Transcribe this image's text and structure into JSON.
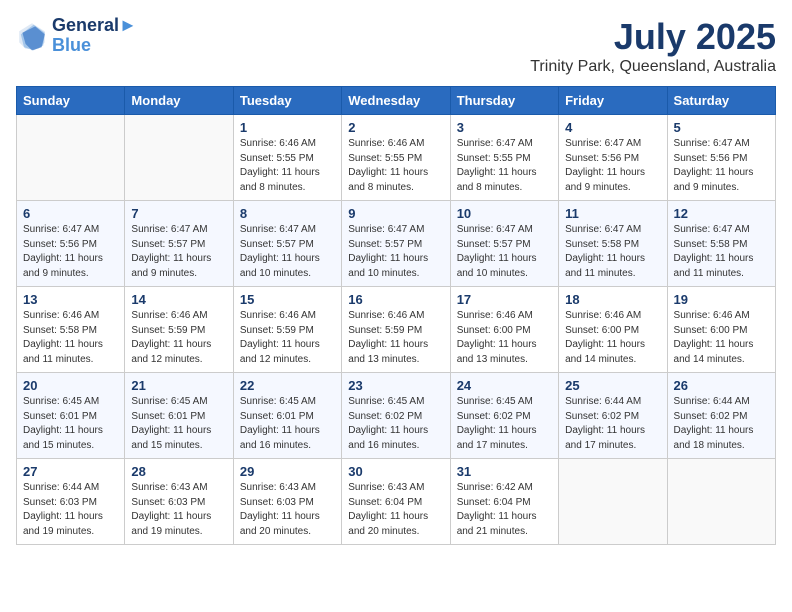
{
  "header": {
    "logo_line1": "General",
    "logo_line2": "Blue",
    "title": "July 2025",
    "subtitle": "Trinity Park, Queensland, Australia"
  },
  "weekdays": [
    "Sunday",
    "Monday",
    "Tuesday",
    "Wednesday",
    "Thursday",
    "Friday",
    "Saturday"
  ],
  "weeks": [
    [
      {
        "day": "",
        "info": ""
      },
      {
        "day": "",
        "info": ""
      },
      {
        "day": "1",
        "info": "Sunrise: 6:46 AM\nSunset: 5:55 PM\nDaylight: 11 hours and 8 minutes."
      },
      {
        "day": "2",
        "info": "Sunrise: 6:46 AM\nSunset: 5:55 PM\nDaylight: 11 hours and 8 minutes."
      },
      {
        "day": "3",
        "info": "Sunrise: 6:47 AM\nSunset: 5:55 PM\nDaylight: 11 hours and 8 minutes."
      },
      {
        "day": "4",
        "info": "Sunrise: 6:47 AM\nSunset: 5:56 PM\nDaylight: 11 hours and 9 minutes."
      },
      {
        "day": "5",
        "info": "Sunrise: 6:47 AM\nSunset: 5:56 PM\nDaylight: 11 hours and 9 minutes."
      }
    ],
    [
      {
        "day": "6",
        "info": "Sunrise: 6:47 AM\nSunset: 5:56 PM\nDaylight: 11 hours and 9 minutes."
      },
      {
        "day": "7",
        "info": "Sunrise: 6:47 AM\nSunset: 5:57 PM\nDaylight: 11 hours and 9 minutes."
      },
      {
        "day": "8",
        "info": "Sunrise: 6:47 AM\nSunset: 5:57 PM\nDaylight: 11 hours and 10 minutes."
      },
      {
        "day": "9",
        "info": "Sunrise: 6:47 AM\nSunset: 5:57 PM\nDaylight: 11 hours and 10 minutes."
      },
      {
        "day": "10",
        "info": "Sunrise: 6:47 AM\nSunset: 5:57 PM\nDaylight: 11 hours and 10 minutes."
      },
      {
        "day": "11",
        "info": "Sunrise: 6:47 AM\nSunset: 5:58 PM\nDaylight: 11 hours and 11 minutes."
      },
      {
        "day": "12",
        "info": "Sunrise: 6:47 AM\nSunset: 5:58 PM\nDaylight: 11 hours and 11 minutes."
      }
    ],
    [
      {
        "day": "13",
        "info": "Sunrise: 6:46 AM\nSunset: 5:58 PM\nDaylight: 11 hours and 11 minutes."
      },
      {
        "day": "14",
        "info": "Sunrise: 6:46 AM\nSunset: 5:59 PM\nDaylight: 11 hours and 12 minutes."
      },
      {
        "day": "15",
        "info": "Sunrise: 6:46 AM\nSunset: 5:59 PM\nDaylight: 11 hours and 12 minutes."
      },
      {
        "day": "16",
        "info": "Sunrise: 6:46 AM\nSunset: 5:59 PM\nDaylight: 11 hours and 13 minutes."
      },
      {
        "day": "17",
        "info": "Sunrise: 6:46 AM\nSunset: 6:00 PM\nDaylight: 11 hours and 13 minutes."
      },
      {
        "day": "18",
        "info": "Sunrise: 6:46 AM\nSunset: 6:00 PM\nDaylight: 11 hours and 14 minutes."
      },
      {
        "day": "19",
        "info": "Sunrise: 6:46 AM\nSunset: 6:00 PM\nDaylight: 11 hours and 14 minutes."
      }
    ],
    [
      {
        "day": "20",
        "info": "Sunrise: 6:45 AM\nSunset: 6:01 PM\nDaylight: 11 hours and 15 minutes."
      },
      {
        "day": "21",
        "info": "Sunrise: 6:45 AM\nSunset: 6:01 PM\nDaylight: 11 hours and 15 minutes."
      },
      {
        "day": "22",
        "info": "Sunrise: 6:45 AM\nSunset: 6:01 PM\nDaylight: 11 hours and 16 minutes."
      },
      {
        "day": "23",
        "info": "Sunrise: 6:45 AM\nSunset: 6:02 PM\nDaylight: 11 hours and 16 minutes."
      },
      {
        "day": "24",
        "info": "Sunrise: 6:45 AM\nSunset: 6:02 PM\nDaylight: 11 hours and 17 minutes."
      },
      {
        "day": "25",
        "info": "Sunrise: 6:44 AM\nSunset: 6:02 PM\nDaylight: 11 hours and 17 minutes."
      },
      {
        "day": "26",
        "info": "Sunrise: 6:44 AM\nSunset: 6:02 PM\nDaylight: 11 hours and 18 minutes."
      }
    ],
    [
      {
        "day": "27",
        "info": "Sunrise: 6:44 AM\nSunset: 6:03 PM\nDaylight: 11 hours and 19 minutes."
      },
      {
        "day": "28",
        "info": "Sunrise: 6:43 AM\nSunset: 6:03 PM\nDaylight: 11 hours and 19 minutes."
      },
      {
        "day": "29",
        "info": "Sunrise: 6:43 AM\nSunset: 6:03 PM\nDaylight: 11 hours and 20 minutes."
      },
      {
        "day": "30",
        "info": "Sunrise: 6:43 AM\nSunset: 6:04 PM\nDaylight: 11 hours and 20 minutes."
      },
      {
        "day": "31",
        "info": "Sunrise: 6:42 AM\nSunset: 6:04 PM\nDaylight: 11 hours and 21 minutes."
      },
      {
        "day": "",
        "info": ""
      },
      {
        "day": "",
        "info": ""
      }
    ]
  ]
}
